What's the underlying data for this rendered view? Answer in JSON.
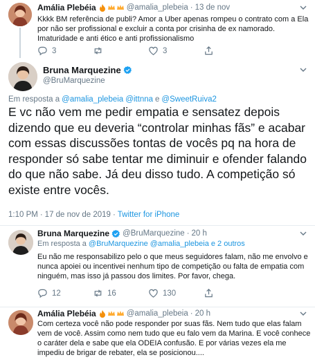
{
  "reply1": {
    "name": "Amália Plebéia",
    "handle": "@amalia_plebeia",
    "sep": "·",
    "time": "13 de nov",
    "text": "Kkkk BM referência de publi? Amor a Uber apenas  rompeu o contrato com a Ela  por não ser profissional e excluir a conta por crisinha de ex namorado. Imaturidade e anti ético e anti profissionalismo",
    "replies": "3",
    "likes": "3"
  },
  "main": {
    "name": "Bruna Marquezine",
    "handle": "@BruMarquezine",
    "reply_prefix": "Em resposta a",
    "reply_to": [
      "@amalia_plebeia",
      "@ittnna",
      "@SweetRuiva2"
    ],
    "conj": "e",
    "text": "E vc não vem me pedir empatia e sensatez depois dizendo que eu deveria “controlar minhas fãs” e acabar com essas discussões tontas de vocês pq na hora de responder só sabe tentar me diminuir e ofender falando do que não sabe. Já deu disso tudo. A competição só existe entre vocês.",
    "time": "1:10 PM",
    "sep": "·",
    "date": "17 de nov de 2019",
    "source": "Twitter for iPhone"
  },
  "reply2": {
    "name": "Bruna Marquezine",
    "handle": "@BruMarquezine",
    "sep": "·",
    "time": "20 h",
    "reply_prefix": "Em resposta a",
    "reply_to_1": "@BruMarquezine",
    "reply_to_2": "@amalia_plebeia",
    "reply_suffix": "e 2 outros",
    "text": "Eu não me responsabilizo pelo o que meus seguidores falam, não me envolvo e nunca apoiei ou incentivei nenhum tipo de competição ou falta de empatia com ninguém, mas isso já passou dos limites. Por favor, chega.",
    "replies": "12",
    "retweets": "16",
    "likes": "130"
  },
  "reply3": {
    "name": "Amália Plebéia",
    "handle": "@amalia_plebeia",
    "sep": "·",
    "time": "20 h",
    "text": "Com certeza você não pode responder por suas fãs. Nem tudo que elas falam vem de você. Assim como nem tudo que eu falo vem da Marina. E você conhece o caráter dela e sabe que ela ODEIA confusão. E por várias vezes ela me impediu de brigar de rebater, ela se posicionou...."
  },
  "icons": {
    "reply": "reply-icon",
    "retweet": "retweet-icon",
    "like": "heart-icon",
    "share": "share-icon",
    "verified": "verified-badge-icon",
    "emojis": "fire-crown-emoji-icons",
    "chevron": "chevron-down-icon"
  },
  "colors": {
    "link": "#1b95e0",
    "grey": "#657786",
    "text": "#14171a",
    "divider": "#e6ecf0"
  }
}
